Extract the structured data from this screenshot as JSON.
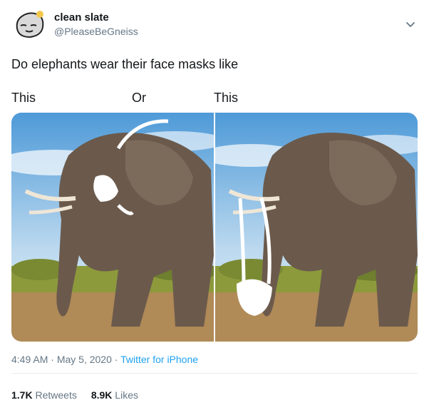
{
  "user": {
    "name": "clean slate",
    "handle": "@PleaseBeGneiss"
  },
  "icons": {
    "avatar": "rock-cartoon-avatar",
    "menu": "chevron-down-icon"
  },
  "tweet": {
    "text": "Do elephants wear their face masks like",
    "options": [
      "This",
      "Or",
      "This"
    ]
  },
  "media": {
    "left_alt": "Elephant with white mask drawn over its eye",
    "right_alt": "Elephant with white mask drawn hanging on its trunk"
  },
  "meta": {
    "time": "4:49 AM",
    "sep1": " · ",
    "date": "May 5, 2020",
    "sep2": " · ",
    "source": "Twitter for iPhone"
  },
  "stats": {
    "retweets_count": "1.7K",
    "retweets_label": "Retweets",
    "likes_count": "8.9K",
    "likes_label": "Likes"
  },
  "colors": {
    "accent": "#1da1f2",
    "secondary": "#657786",
    "divider": "#e6ecf0"
  }
}
